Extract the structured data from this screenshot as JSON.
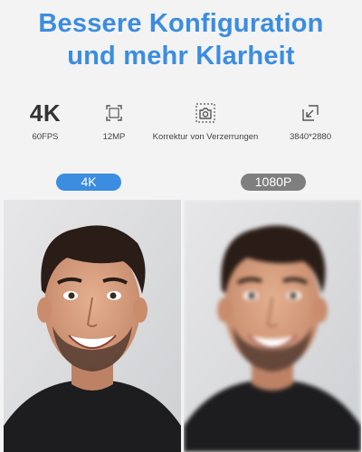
{
  "headline": {
    "line1": "Bessere Konfiguration",
    "line2": "und mehr Klarheit"
  },
  "specs": [
    {
      "icon": "4k-text",
      "value": "4K",
      "label": "60FPS"
    },
    {
      "icon": "fullscreen-frame-icon",
      "label": "12MP"
    },
    {
      "icon": "distortion-correction-icon",
      "label": "Korrektur von Verzerrungen"
    },
    {
      "icon": "resolution-arrow-icon",
      "label": "3840*2880"
    }
  ],
  "comparison": {
    "left_badge": "4K",
    "right_badge": "1080P"
  },
  "colors": {
    "accent": "#3b8de0",
    "badge_gray": "#7f7f7f",
    "background": "#f3f3f3"
  }
}
